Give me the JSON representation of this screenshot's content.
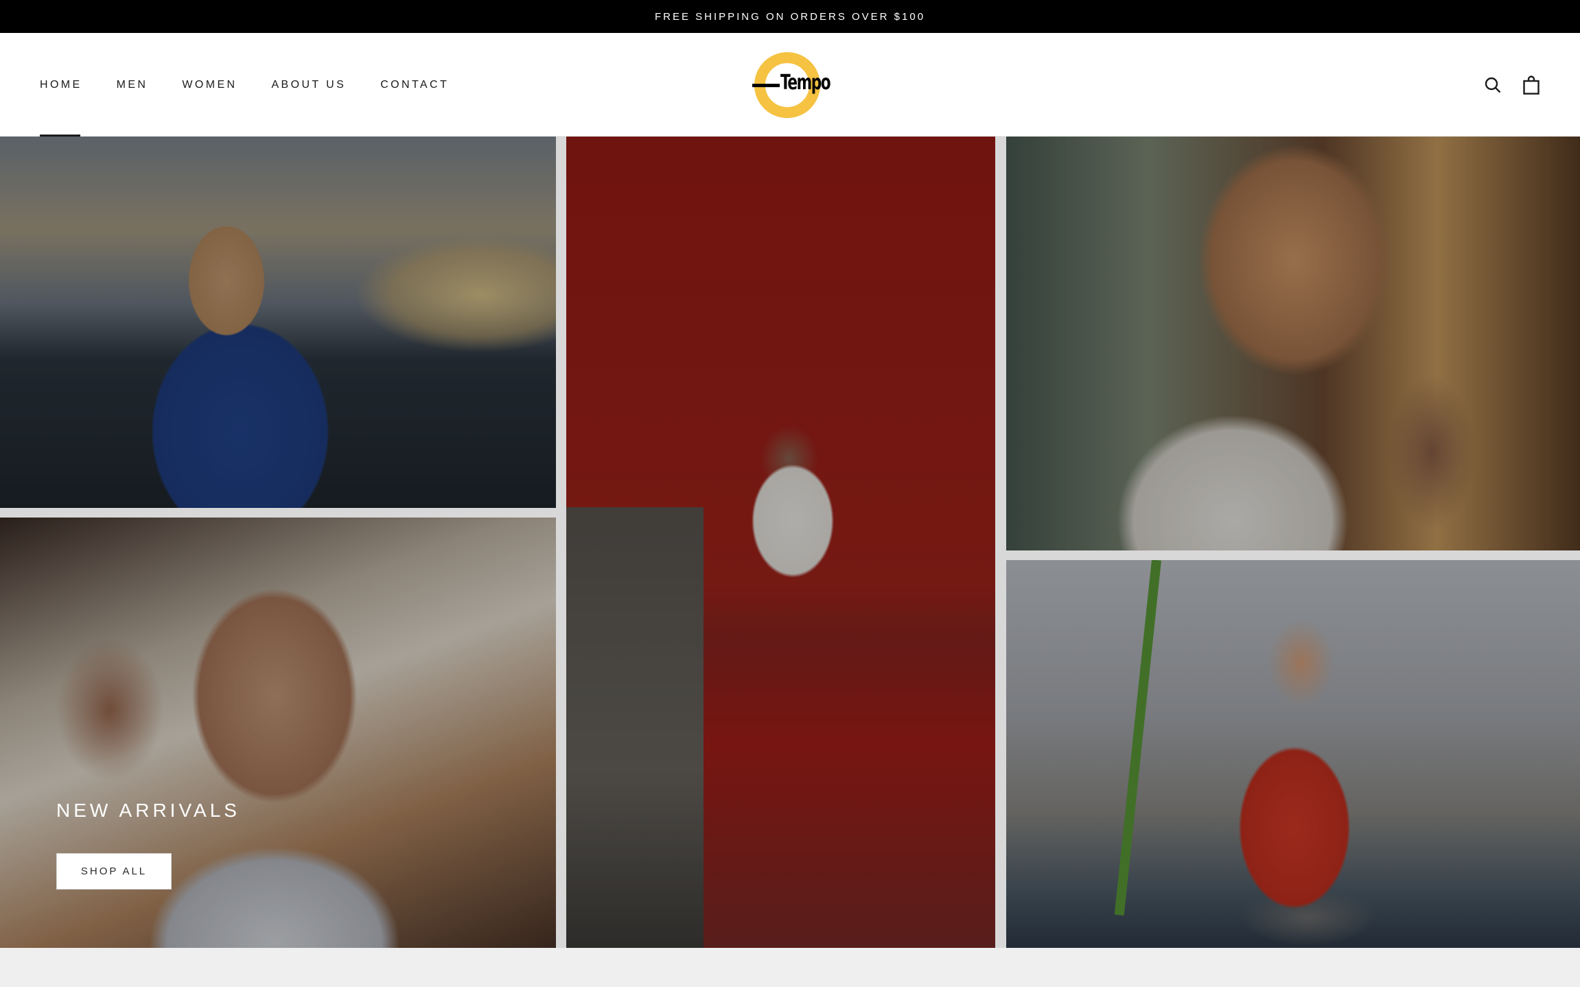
{
  "announcement": {
    "text": "FREE SHIPPING ON ORDERS OVER $100"
  },
  "header": {
    "nav": [
      {
        "label": "HOME",
        "active": true
      },
      {
        "label": "MEN",
        "active": false
      },
      {
        "label": "WOMEN",
        "active": false
      },
      {
        "label": "ABOUT US",
        "active": false
      },
      {
        "label": "CONTACT",
        "active": false
      }
    ],
    "logo": {
      "text": "Tempo",
      "ring_color": "#f5c242"
    },
    "icons": {
      "search": "search-icon",
      "cart": "shopping-bag-icon"
    }
  },
  "hero": {
    "title": "NEW ARRIVALS",
    "button_label": "SHOP ALL",
    "images": [
      {
        "name": "woman-blue-48-shirt-fair"
      },
      {
        "name": "couple-sunglasses"
      },
      {
        "name": "woman-red-brick-wall"
      },
      {
        "name": "man-profile-sunlight"
      },
      {
        "name": "woman-red-top-ride"
      }
    ]
  },
  "colors": {
    "announcement_bg": "#000000",
    "header_bg": "#ffffff",
    "page_bg": "#efefef",
    "accent": "#f5c242"
  }
}
